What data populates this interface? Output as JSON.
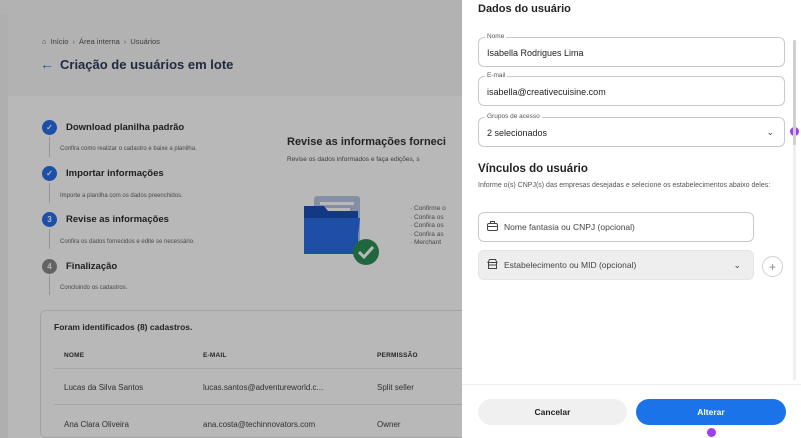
{
  "breadcrumb": {
    "home": "Início",
    "area": "Área interna",
    "users": "Usuários"
  },
  "page_title": "Criação de usuários em lote",
  "steps": [
    {
      "number": "",
      "label": "Download planilha padrão",
      "desc": "Confira como realizar o cadastro e baixe a planilha.",
      "state": "done"
    },
    {
      "number": "",
      "label": "Importar informações",
      "desc": "Importe a planilha com os dados preenchidos.",
      "state": "done"
    },
    {
      "number": "3",
      "label": "Revise as informações",
      "desc": "Confira os dados fornecidos e edite se necessário.",
      "state": "active"
    },
    {
      "number": "4",
      "label": "Finalização",
      "desc": "Concluindo os cadastros.",
      "state": "pending"
    }
  ],
  "review": {
    "title": "Revise as informações forneci",
    "subtitle": "Revise os dados informados e faça edições, s",
    "bullets": [
      "· Confirme o",
      "· Confira os",
      "· Confira os",
      "· Confira as",
      "· Merchant"
    ]
  },
  "table": {
    "title": "Foram identificados (8) cadastros.",
    "headers": {
      "name": "NOME",
      "email": "E-MAIL",
      "permission": "PERMISSÃO"
    },
    "rows": [
      {
        "name": "Lucas da Silva Santos",
        "email": "lucas.santos@adventureworld.c...",
        "permission": "Split seller"
      },
      {
        "name": "Ana Clara Oliveira",
        "email": "ana.costa@techinnovators.com",
        "permission": "Owner"
      }
    ]
  },
  "panel": {
    "title": "Dados do usuário",
    "name_label": "Nome",
    "name_value": "Isabella Rodrigues Lima",
    "email_label": "E-mail",
    "email_value": "isabella@creativecuisine.com",
    "groups_label": "Grupos de acesso",
    "groups_value": "2 selecionados",
    "links_title": "Vínculos do usuário",
    "links_desc": "Informe o(s) CNPJ(s) das empresas desejadas e selecione os estabelecimentos abaixo deles:",
    "cnpj_placeholder": "Nome fantasia ou CNPJ (opcional)",
    "establishment_placeholder": "Estabelecimento ou MID (opcional)",
    "cancel_label": "Cancelar",
    "alter_label": "Alterar"
  },
  "colors": {
    "accent": "#1a73e8",
    "step_done": "#2a6ee8",
    "pin": "#9b3ff0"
  }
}
